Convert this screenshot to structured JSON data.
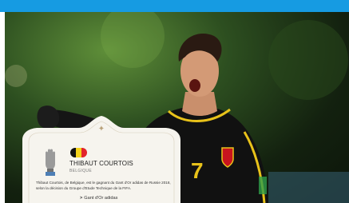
{
  "colors": {
    "topbar": "#169be2",
    "card": "#f6f4ee",
    "jersey": "#111111",
    "jersey_trim": "#e8c21a",
    "flag": [
      "#111111",
      "#f3d21c",
      "#e2242b"
    ]
  },
  "card": {
    "ornament_icon": "diamond-star-icon",
    "award_icon": "golden-glove-icon",
    "flag_icon": "belgium-flag-icon",
    "name": "THIBAUT COURTOIS",
    "country": "BELGIQUE",
    "description": "Thibaut Courtois, de Belgique, est le gagnant du Gant d'Or adidas de Russie 2018, selon la décision du Groupe d'Etude Technique de la FIFA.",
    "link_icon": "chevron-right-icon",
    "link_label": "Gant d'Or adidas"
  },
  "hero": {
    "jersey_number": "7"
  }
}
